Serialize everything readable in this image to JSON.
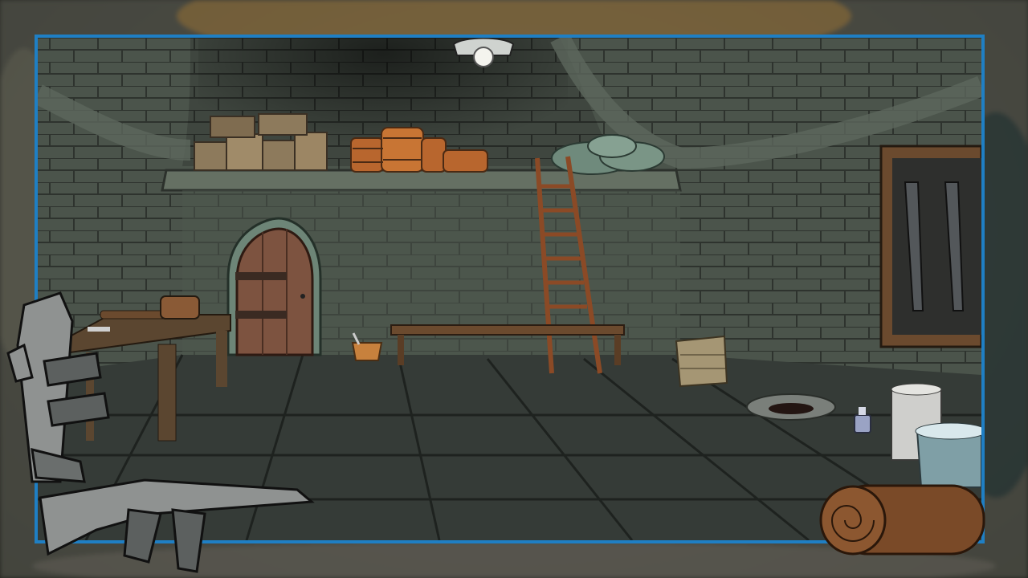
{
  "colors": {
    "frame_border": "#1f7fc4",
    "wall": "#4b544b",
    "floor": "#3a403c",
    "wood": "#6b4a2e"
  },
  "scene": {
    "objects": [
      {
        "id": "ceiling-lamp",
        "icon": "lamp-icon"
      },
      {
        "id": "crates-shelf",
        "icon": "crates-icon"
      },
      {
        "id": "barrels",
        "icon": "barrel-icon"
      },
      {
        "id": "rocks-pile",
        "icon": "rocks-icon"
      },
      {
        "id": "wooden-door",
        "icon": "door-icon"
      },
      {
        "id": "wooden-ladder",
        "icon": "ladder-icon"
      },
      {
        "id": "wooden-bench",
        "icon": "bench-icon"
      },
      {
        "id": "workbench-table",
        "icon": "table-icon"
      },
      {
        "id": "bucket-small",
        "icon": "bucket-icon"
      },
      {
        "id": "basket",
        "icon": "basket-icon"
      },
      {
        "id": "floor-drain",
        "icon": "drain-icon"
      },
      {
        "id": "small-bottle",
        "icon": "bottle-icon"
      },
      {
        "id": "paint-can",
        "icon": "can-icon"
      },
      {
        "id": "water-bucket",
        "icon": "bucket-icon"
      },
      {
        "id": "weapon-rack",
        "icon": "rifle-icon"
      }
    ]
  },
  "overlay": {
    "decorations": [
      {
        "id": "rifle-vertical",
        "icon": "rifle-icon"
      },
      {
        "id": "rifle-horizontal",
        "icon": "rifle-icon"
      },
      {
        "id": "rolled-mat",
        "icon": "roll-icon"
      }
    ]
  }
}
